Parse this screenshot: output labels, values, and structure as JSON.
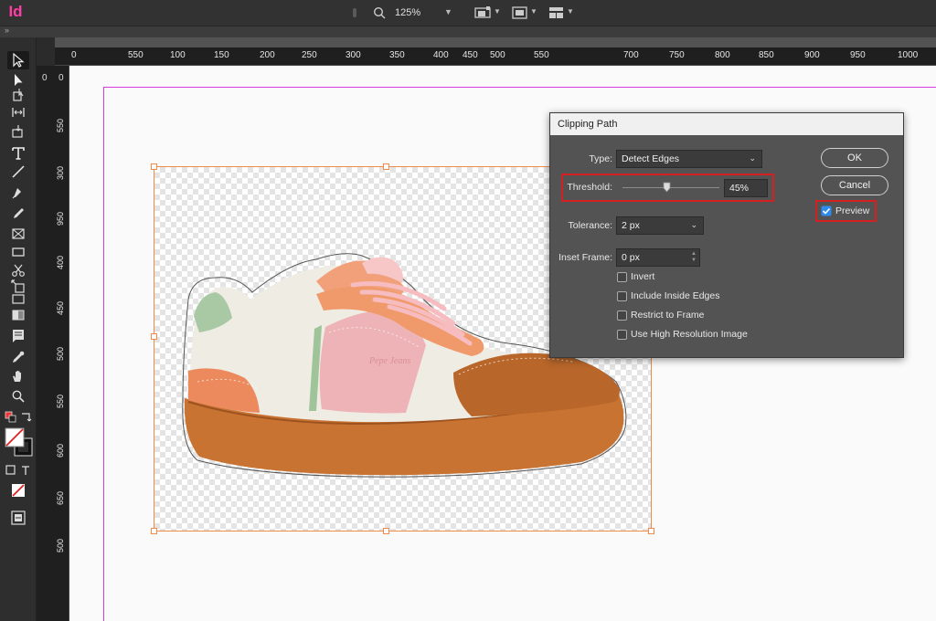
{
  "app": {
    "logo": "Id"
  },
  "appbar": {
    "zoom": "125%"
  },
  "ruler": {
    "h_labels": [
      "0",
      "550",
      "100",
      "150",
      "200",
      "250",
      "300",
      "350",
      "400",
      "450",
      "500",
      "550",
      "700",
      "750",
      "800",
      "850",
      "900",
      "950",
      "1000"
    ],
    "v_labels": [
      "0",
      "0",
      "550",
      "300",
      "950",
      "400",
      "450",
      "500",
      "550",
      "600",
      "650",
      "500"
    ]
  },
  "dialog": {
    "title": "Clipping Path",
    "type_label": "Type:",
    "type_value": "Detect Edges",
    "threshold_label": "Threshold:",
    "threshold_value": "45%",
    "threshold_level": 0.45,
    "tolerance_label": "Tolerance:",
    "tolerance_value": "2 px",
    "inset_label": "Inset Frame:",
    "inset_value": "0 px",
    "ok_label": "OK",
    "cancel_label": "Cancel",
    "preview_label": "Preview",
    "preview_checked": true,
    "options": [
      {
        "label": "Invert",
        "checked": false
      },
      {
        "label": "Include Inside Edges",
        "checked": false
      },
      {
        "label": "Restrict to Frame",
        "checked": false
      },
      {
        "label": "Use High Resolution Image",
        "checked": false
      }
    ]
  },
  "colors": {
    "app_accent": "#ff3ea5",
    "page_margin": "#d63adc",
    "frame_selection": "#f08a4b",
    "highlight_box": "#d42020",
    "checkbox_on": "#2d8ceb"
  }
}
